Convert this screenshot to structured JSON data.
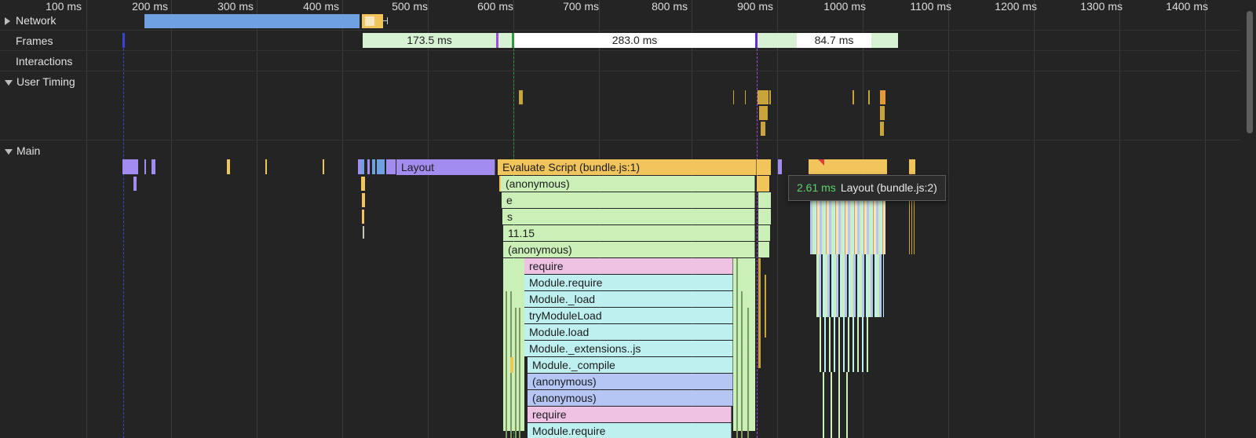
{
  "ruler": {
    "ticks": [
      "100 ms",
      "200 ms",
      "300 ms",
      "400 ms",
      "500 ms",
      "600 ms",
      "700 ms",
      "800 ms",
      "900 ms",
      "1000 ms",
      "1100 ms",
      "1200 ms",
      "1300 ms",
      "1400 ms"
    ]
  },
  "tracks": {
    "network": {
      "label": "Network",
      "expanded": false
    },
    "frames": {
      "label": "Frames",
      "durations": [
        "173.5 ms",
        "283.0 ms",
        "84.7 ms"
      ]
    },
    "interactions": {
      "label": "Interactions"
    },
    "user_timing": {
      "label": "User Timing",
      "expanded": true
    },
    "main": {
      "label": "Main",
      "expanded": true
    }
  },
  "flame": {
    "layout_label": "Layout",
    "evaluate_label": "Evaluate Script (bundle.js:1)",
    "anon1": "(anonymous)",
    "e_label": "e",
    "s_label": "s",
    "v1115": "11.15",
    "anon2": "(anonymous)",
    "require1": "require",
    "module_require1": "Module.require",
    "module_load_private": "Module._load",
    "try_module_load": "tryModuleLoad",
    "module_load": "Module.load",
    "module_extensions": "Module._extensions..js",
    "module_compile": "Module._compile",
    "anon3": "(anonymous)",
    "anon4": "(anonymous)",
    "require2": "require",
    "module_require2": "Module.require"
  },
  "tooltip": {
    "duration": "2.61 ms",
    "label": "Layout (bundle.js:2)"
  },
  "colors": {
    "scripting": "#f2c55c",
    "rendering": "#a38cf0",
    "network_bar": "#6fa0e0",
    "frame_good": "#d7f1d3",
    "frame_white": "#ffffff",
    "green_call": "#cbf0b7",
    "pink_call": "#efc2e3",
    "cyan_call": "#bdf0ee",
    "blue_call": "#b5c6f5",
    "user_timing": "#c8a43a"
  }
}
